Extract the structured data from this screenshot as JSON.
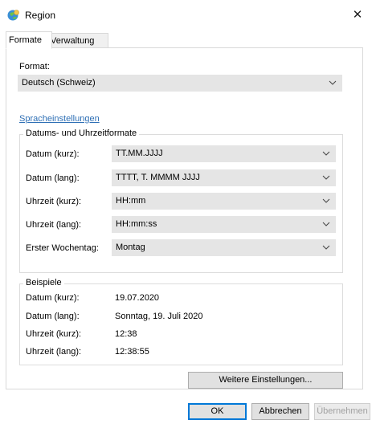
{
  "window": {
    "title": "Region",
    "close_glyph": "✕"
  },
  "tabs": [
    {
      "label": "Formate",
      "active": true
    },
    {
      "label": "Verwaltung",
      "active": false
    }
  ],
  "format": {
    "label": "Format:",
    "value": "Deutsch (Schweiz)"
  },
  "language_link": "Spracheinstellungen",
  "formats_group": {
    "title": "Datums- und Uhrzeitformate",
    "rows": [
      {
        "label": "Datum (kurz):",
        "value": "TT.MM.JJJJ"
      },
      {
        "label": "Datum (lang):",
        "value": "TTTT, T. MMMM JJJJ"
      },
      {
        "label": "Uhrzeit (kurz):",
        "value": "HH:mm"
      },
      {
        "label": "Uhrzeit (lang):",
        "value": "HH:mm:ss"
      },
      {
        "label": "Erster Wochentag:",
        "value": "Montag"
      }
    ]
  },
  "examples_group": {
    "title": "Beispiele",
    "rows": [
      {
        "label": "Datum (kurz):",
        "value": "19.07.2020"
      },
      {
        "label": "Datum (lang):",
        "value": "Sonntag, 19. Juli 2020"
      },
      {
        "label": "Uhrzeit (kurz):",
        "value": "12:38"
      },
      {
        "label": "Uhrzeit (lang):",
        "value": "12:38:55"
      }
    ]
  },
  "buttons": {
    "more_settings": "Weitere Einstellungen...",
    "ok": "OK",
    "cancel": "Abbrechen",
    "apply": "Übernehmen"
  },
  "colors": {
    "link": "#2e6fb5",
    "default_border": "#0078d7",
    "select_bg": "#e5e5e5"
  },
  "icons": {
    "app": "globe-clock-icon",
    "dropdown": "chevron-down-icon"
  }
}
